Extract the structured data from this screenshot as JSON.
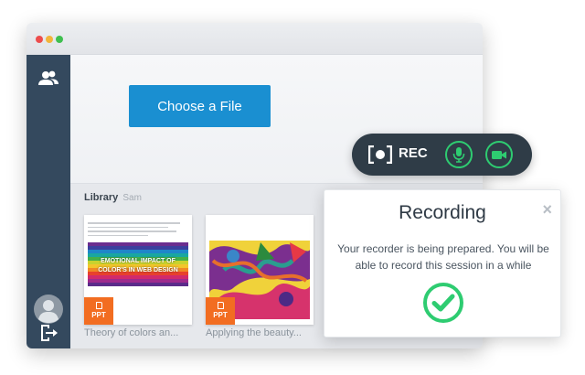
{
  "window": {
    "traffic_lights": [
      "#ed4d4d",
      "#f2b53b",
      "#3fbf4f"
    ]
  },
  "sidebar": {
    "items": [
      {
        "icon": "users-icon"
      },
      {
        "icon": "avatar-icon"
      },
      {
        "icon": "logout-icon"
      }
    ],
    "background": "#34495e"
  },
  "main": {
    "choose_file_label": "Choose a File",
    "accent": "#1a8fd1"
  },
  "library": {
    "title": "Library",
    "owner": "Sam",
    "items": [
      {
        "title": "Theory of colors an...",
        "badge": "PPT",
        "slide_text_line1": "EMOTIONAL IMPACT OF",
        "slide_text_line2": "COLOR'S IN WEB DESIGN"
      },
      {
        "title": "Applying the beauty...",
        "badge": "PPT"
      }
    ],
    "badge_color": "#f26d21"
  },
  "recorder": {
    "rec_label": "REC",
    "mic_icon": "microphone-icon",
    "camera_icon": "video-camera-icon",
    "accent": "#2ecc71"
  },
  "panel": {
    "title": "Recording",
    "message": "Your recorder is being prepared. You will be able to record this session in a while",
    "close_glyph": "×",
    "status_icon": "check-circle-icon"
  }
}
